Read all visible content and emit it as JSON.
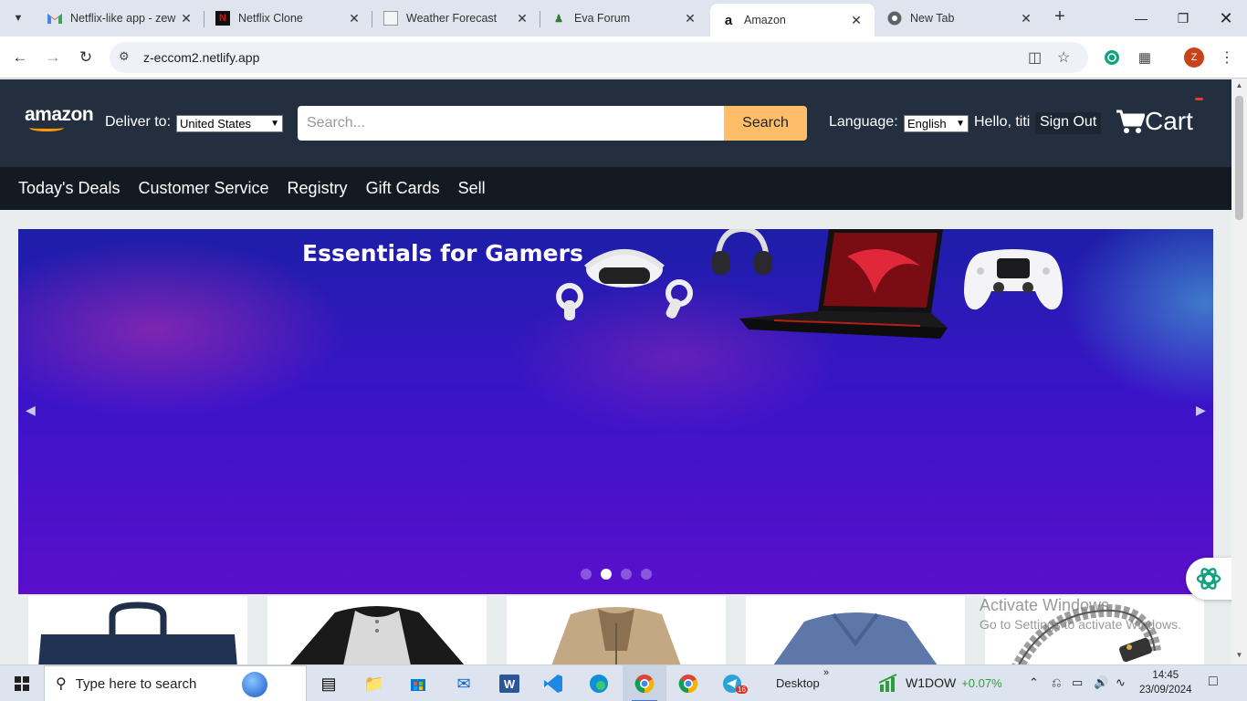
{
  "browser": {
    "tabs": [
      {
        "title": "Netflix-like app - zew",
        "favicon": "gmail-icon",
        "active": false
      },
      {
        "title": "Netflix Clone",
        "favicon": "netflix-icon",
        "active": false
      },
      {
        "title": "Weather Forecast",
        "favicon": "weather-icon",
        "active": false
      },
      {
        "title": "Eva Forum",
        "favicon": "forum-icon",
        "active": false
      },
      {
        "title": "Amazon",
        "favicon": "amazon-icon",
        "active": true
      },
      {
        "title": "New Tab",
        "favicon": "chrome-icon",
        "active": false
      }
    ],
    "url": "z-eccom2.netlify.app",
    "profile_initial": "Z"
  },
  "amazon": {
    "logo": "amazon",
    "deliver_label": "Deliver to:",
    "deliver_value": "United States",
    "search_placeholder": "Search...",
    "search_button": "Search",
    "language_label": "Language:",
    "language_value": "English",
    "greeting": "Hello, titi",
    "signout": "Sign Out",
    "cart_label": "Cart",
    "subnav": [
      "Today's Deals",
      "Customer Service",
      "Registry",
      "Gift Cards",
      "Sell"
    ],
    "hero": {
      "title": "Essentials for Gamers",
      "slides": 4,
      "active_slide": 2
    },
    "products": [
      "bag",
      "raglan-shirt",
      "jacket",
      "v-neck-tshirt",
      "bracelet"
    ]
  },
  "watermark": {
    "line1": "Activate Windows",
    "line2": "Go to Settings to activate Windows."
  },
  "taskbar": {
    "search_placeholder": "Type here to search",
    "desktop_label": "Desktop",
    "ticker_name": "W1DOW",
    "ticker_change": "+0.07%",
    "telegram_badge": "16",
    "time": "14:45",
    "date": "23/09/2024"
  },
  "colors": {
    "amazon_dark": "#232f3e",
    "amazon_subnav": "#131a22",
    "search_button": "#febd69",
    "ticker_green": "#2e9e3a"
  }
}
